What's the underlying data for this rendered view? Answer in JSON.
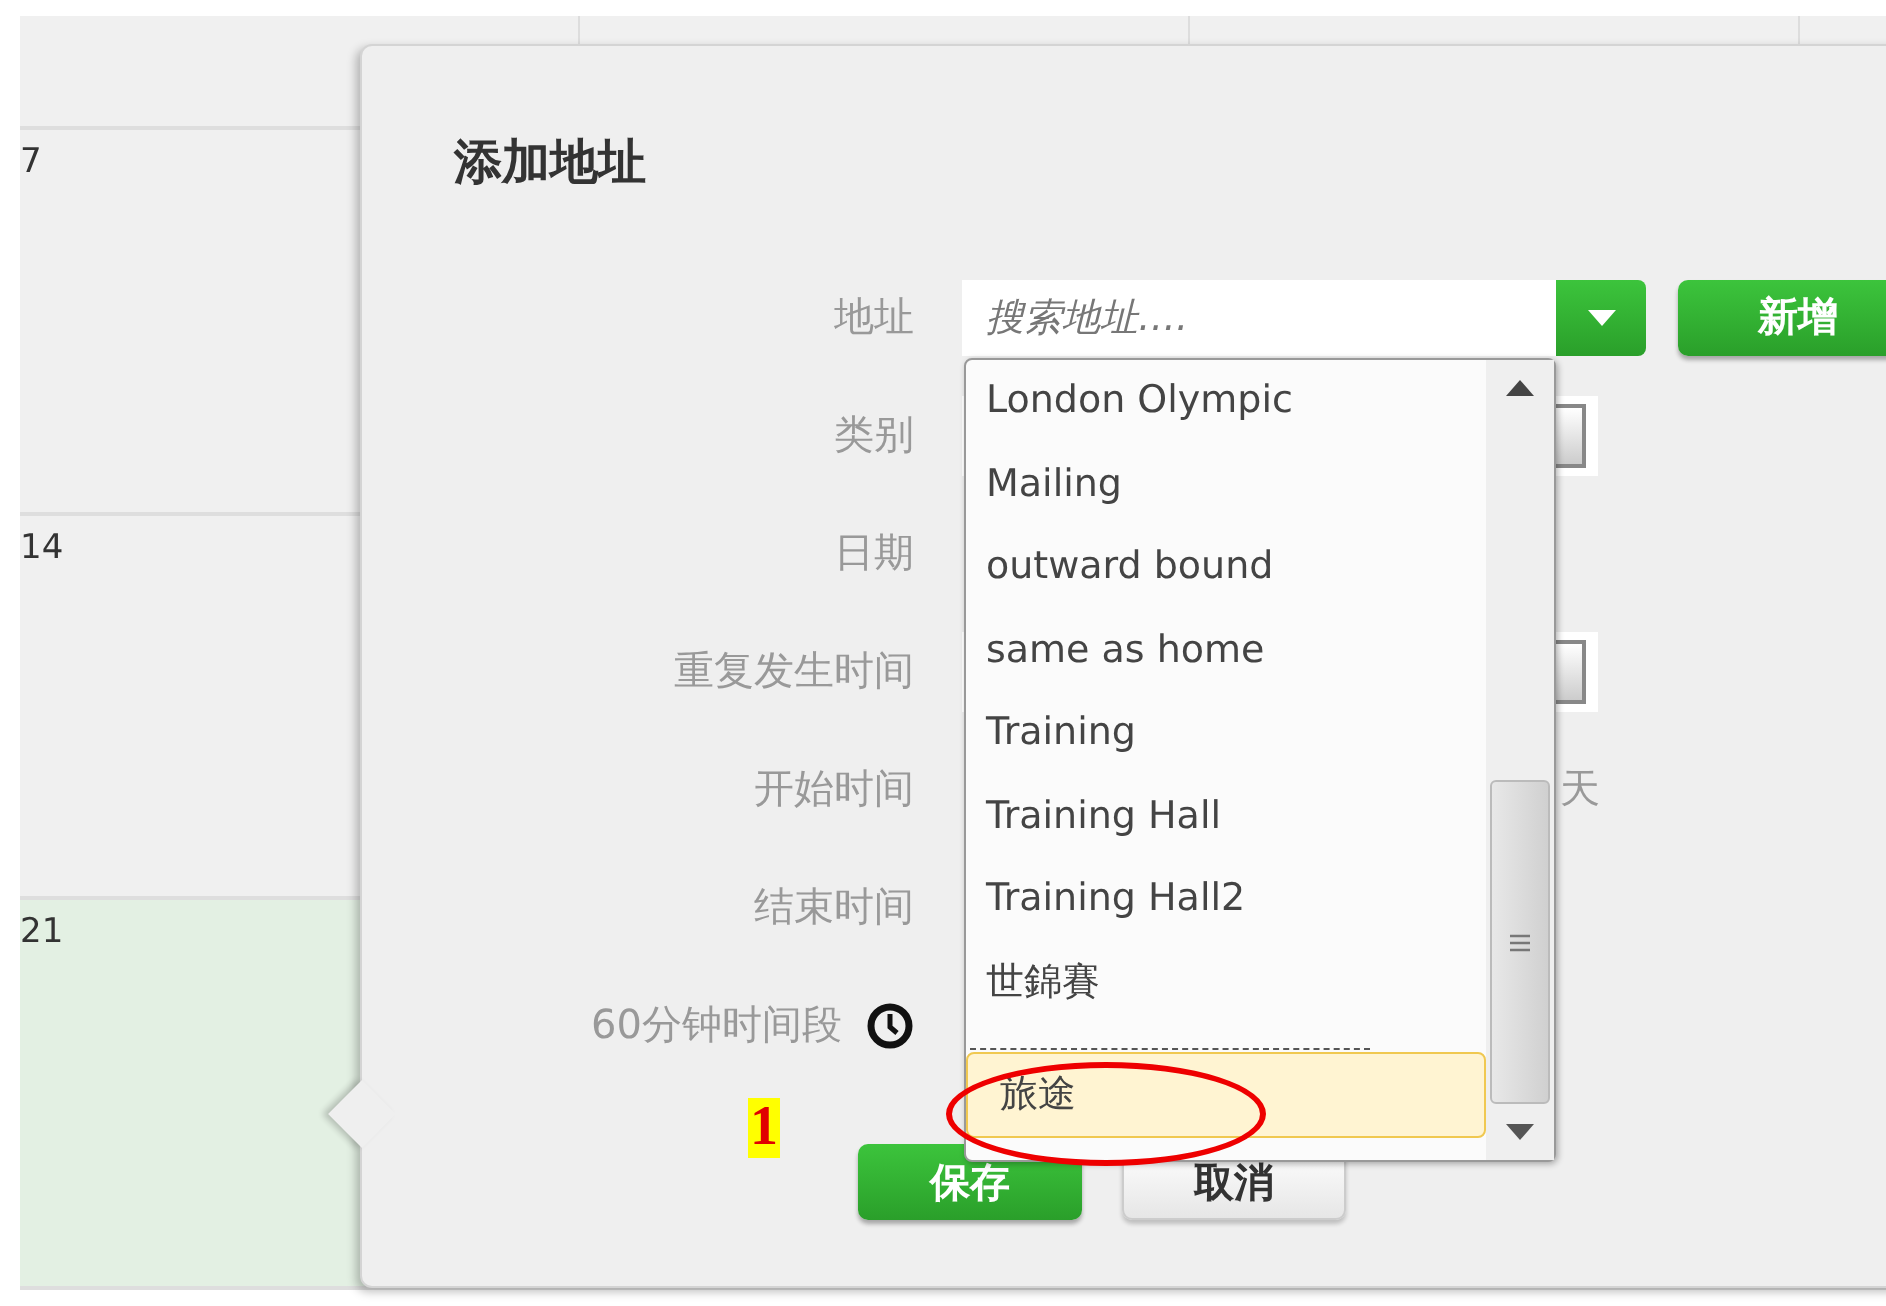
{
  "calendar": {
    "rows": [
      {
        "day": "",
        "highlighted": false
      },
      {
        "day": "7",
        "highlighted": false
      },
      {
        "day": "14",
        "highlighted": false
      },
      {
        "day": "21",
        "highlighted": true
      }
    ]
  },
  "dialog": {
    "title": "添加地址",
    "fields": [
      {
        "kind": "address",
        "label": "地址",
        "placeholder": "搜索地址….",
        "add_button": "新增"
      },
      {
        "kind": "select",
        "label": "类别"
      },
      {
        "kind": "blank",
        "label": "日期"
      },
      {
        "kind": "select",
        "label": "重复发生时间"
      },
      {
        "kind": "suffix",
        "label": "开始时间",
        "suffix": "天"
      },
      {
        "kind": "blank",
        "label": "结束时间"
      },
      {
        "kind": "icon",
        "label": "60分钟时间段"
      }
    ],
    "buttons": [
      {
        "kind": "primary",
        "label": "保存"
      },
      {
        "kind": "secondary",
        "label": "取消"
      }
    ],
    "dropdown": {
      "options": [
        {
          "kind": "option",
          "label": "London Olympic",
          "selected": false
        },
        {
          "kind": "option",
          "label": "Mailing",
          "selected": false
        },
        {
          "kind": "option",
          "label": "outward bound",
          "selected": false
        },
        {
          "kind": "option",
          "label": "same as home",
          "selected": false
        },
        {
          "kind": "option",
          "label": "Training",
          "selected": false
        },
        {
          "kind": "option",
          "label": "Training Hall",
          "selected": false
        },
        {
          "kind": "option",
          "label": "Training Hall2",
          "selected": false
        },
        {
          "kind": "option",
          "label": "世錦賽",
          "selected": false
        },
        {
          "kind": "separator"
        },
        {
          "kind": "option",
          "label": "旅途",
          "selected": true
        }
      ]
    }
  },
  "annotation": {
    "label": "1"
  }
}
